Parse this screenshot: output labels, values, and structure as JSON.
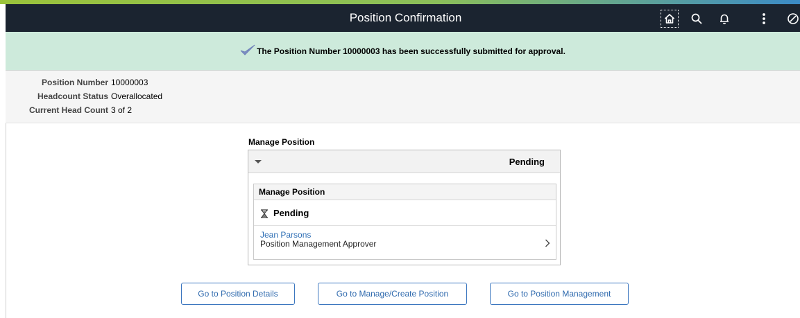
{
  "header": {
    "title": "Position Confirmation",
    "icons": [
      "home-icon",
      "search-icon",
      "bell-icon",
      "more-options-icon",
      "nav-bar-icon"
    ]
  },
  "banner": {
    "message": "The Position Number 10000003 has been successfully submitted for approval.",
    "icon": "checkmark-icon"
  },
  "info": {
    "position_number_label": "Position Number",
    "position_number_value": "10000003",
    "headcount_status_label": "Headcount Status",
    "headcount_status_value": "Overallocated",
    "current_head_count_label": "Current Head Count",
    "current_head_count_value": "3 of 2"
  },
  "manage_position": {
    "title": "Manage Position",
    "header_status": "Pending",
    "card": {
      "title": "Manage Position",
      "status": "Pending",
      "approver_name": "Jean Parsons",
      "approver_role": "Position Management Approver"
    }
  },
  "buttons": {
    "position_details": "Go to Position Details",
    "manage_create": "Go to Manage/Create Position",
    "position_management": "Go to Position Management"
  },
  "colors": {
    "header_bg": "#1b2430",
    "banner_bg": "#cdeadb",
    "link_blue": "#2f6fb5",
    "button_border": "#3b76bf"
  }
}
